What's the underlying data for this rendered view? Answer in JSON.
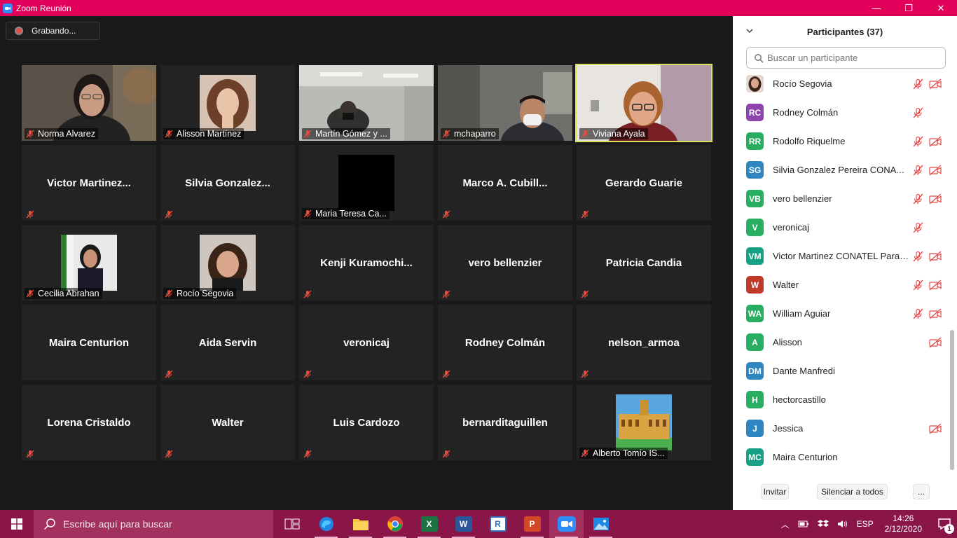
{
  "window": {
    "title": "Zoom Reunión",
    "buttons": [
      "—",
      "❐",
      "✕"
    ]
  },
  "recording": {
    "label": "Grabando..."
  },
  "tiles": [
    {
      "name": "Norma Alvarez",
      "kind": "video",
      "row": 0,
      "col": 0
    },
    {
      "name": "Alisson Martínez",
      "kind": "photo",
      "row": 0,
      "col": 1
    },
    {
      "name": "Martín Gómez y ...",
      "kind": "video",
      "row": 0,
      "col": 2
    },
    {
      "name": "mchaparro",
      "kind": "video",
      "row": 0,
      "col": 3
    },
    {
      "name": "Viviana Ayala",
      "kind": "video",
      "row": 0,
      "col": 4,
      "active": true
    },
    {
      "name": "Victor  Martinez...",
      "kind": "text",
      "row": 1,
      "col": 0
    },
    {
      "name": "Silvia  Gonzalez...",
      "kind": "text",
      "row": 1,
      "col": 1
    },
    {
      "name": "Maria Teresa Ca...",
      "kind": "black",
      "row": 1,
      "col": 2
    },
    {
      "name": "Marco  A.  Cubill...",
      "kind": "text",
      "row": 1,
      "col": 3
    },
    {
      "name": "Gerardo Guarie",
      "kind": "text",
      "row": 1,
      "col": 4
    },
    {
      "name": "Cecilia Abrahan",
      "kind": "photo",
      "row": 2,
      "col": 0
    },
    {
      "name": "Rocío Segovia",
      "kind": "photo",
      "row": 2,
      "col": 1
    },
    {
      "name": "Kenji  Kuramochi...",
      "kind": "text",
      "row": 2,
      "col": 2
    },
    {
      "name": "vero bellenzier",
      "kind": "text",
      "row": 2,
      "col": 3
    },
    {
      "name": "Patricia Candia",
      "kind": "text",
      "row": 2,
      "col": 4
    },
    {
      "name": "Maira Centurion",
      "kind": "text",
      "row": 3,
      "col": 0,
      "nomute": true
    },
    {
      "name": "Aida Servin",
      "kind": "text",
      "row": 3,
      "col": 1
    },
    {
      "name": "veronicaj",
      "kind": "text",
      "row": 3,
      "col": 2
    },
    {
      "name": "Rodney Colmán",
      "kind": "text",
      "row": 3,
      "col": 3
    },
    {
      "name": "nelson_armoa",
      "kind": "text",
      "row": 3,
      "col": 4
    },
    {
      "name": "Lorena Cristaldo",
      "kind": "text",
      "row": 4,
      "col": 0
    },
    {
      "name": "Walter",
      "kind": "text",
      "row": 4,
      "col": 1
    },
    {
      "name": "Luis Cardozo",
      "kind": "text",
      "row": 4,
      "col": 2
    },
    {
      "name": "bernarditaguillen",
      "kind": "text",
      "row": 4,
      "col": 3
    },
    {
      "name": "Alberto Tomío IS...",
      "kind": "photo",
      "row": 4,
      "col": 4
    }
  ],
  "panel": {
    "title": "Participantes (37)",
    "search_placeholder": "Buscar un participante",
    "participants": [
      {
        "name": "Rocío Segovia",
        "initials": "",
        "color": "#c9a08a",
        "mic_muted": true,
        "cam_off": true
      },
      {
        "name": "Rodney Colmán",
        "initials": "RC",
        "color": "#8e44ad",
        "mic_muted": true,
        "cam_off": false
      },
      {
        "name": "Rodolfo Riquelme",
        "initials": "RR",
        "color": "#27ae60",
        "mic_muted": true,
        "cam_off": true
      },
      {
        "name": "Silvia Gonzalez Pereira CONATE...",
        "initials": "SG",
        "color": "#2e86c1",
        "mic_muted": true,
        "cam_off": true
      },
      {
        "name": "vero bellenzier",
        "initials": "VB",
        "color": "#27ae60",
        "mic_muted": true,
        "cam_off": true
      },
      {
        "name": "veronicaj",
        "initials": "V",
        "color": "#27ae60",
        "mic_muted": true,
        "cam_off": false
      },
      {
        "name": "Victor Martinez CONATEL Parag...",
        "initials": "VM",
        "color": "#16a085",
        "mic_muted": true,
        "cam_off": true
      },
      {
        "name": "Walter",
        "initials": "W",
        "color": "#c0392b",
        "mic_muted": true,
        "cam_off": true
      },
      {
        "name": "William Aguiar",
        "initials": "WA",
        "color": "#27ae60",
        "mic_muted": true,
        "cam_off": true
      },
      {
        "name": "Alisson",
        "initials": "A",
        "color": "#27ae60",
        "mic_muted": false,
        "cam_off": true
      },
      {
        "name": "Dante Manfredi",
        "initials": "DM",
        "color": "#2e86c1",
        "mic_muted": false,
        "cam_off": false
      },
      {
        "name": "hectorcastillo",
        "initials": "H",
        "color": "#27ae60",
        "mic_muted": false,
        "cam_off": false
      },
      {
        "name": "Jessica",
        "initials": "J",
        "color": "#2e86c1",
        "mic_muted": false,
        "cam_off": true
      },
      {
        "name": "Maira Centurion",
        "initials": "MC",
        "color": "#16a085",
        "mic_muted": false,
        "cam_off": false
      }
    ],
    "footer": {
      "invite": "Invitar",
      "mute_all": "Silenciar a todos",
      "more": "..."
    }
  },
  "taskbar": {
    "search_placeholder": "Escribe aquí para buscar",
    "apps": [
      {
        "name": "task-view",
        "label": ""
      },
      {
        "name": "edge",
        "label": ""
      },
      {
        "name": "file-explorer",
        "label": ""
      },
      {
        "name": "chrome",
        "label": ""
      },
      {
        "name": "excel",
        "label": "X"
      },
      {
        "name": "word",
        "label": "W"
      },
      {
        "name": "r-app",
        "label": "R"
      },
      {
        "name": "powerpoint",
        "label": "P"
      },
      {
        "name": "zoom",
        "label": ""
      },
      {
        "name": "photos",
        "label": ""
      }
    ],
    "language": "ESP",
    "time": "14:26",
    "date": "2/12/2020",
    "notifications": "1"
  }
}
